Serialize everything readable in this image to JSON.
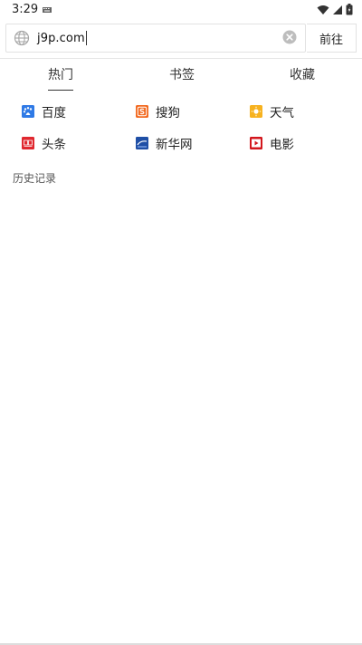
{
  "status": {
    "time": "3:29"
  },
  "url_bar": {
    "value": "j9p.com",
    "go_label": "前往"
  },
  "tabs": [
    {
      "label": "热门",
      "active": true
    },
    {
      "label": "书签",
      "active": false
    },
    {
      "label": "收藏",
      "active": false
    }
  ],
  "sites": [
    {
      "label": "百度",
      "icon": "baidu-icon",
      "color": "#2f7ae6"
    },
    {
      "label": "搜狗",
      "icon": "sogou-icon",
      "color": "#f26a21"
    },
    {
      "label": "天气",
      "icon": "weather-icon",
      "color": "#f7b21f"
    },
    {
      "label": "头条",
      "icon": "toutiao-icon",
      "color": "#e0282f"
    },
    {
      "label": "新华网",
      "icon": "xinhua-icon",
      "color": "#1f4fa6"
    },
    {
      "label": "电影",
      "icon": "movie-icon",
      "color": "#d3171d"
    }
  ],
  "history": {
    "title": "历史记录"
  }
}
